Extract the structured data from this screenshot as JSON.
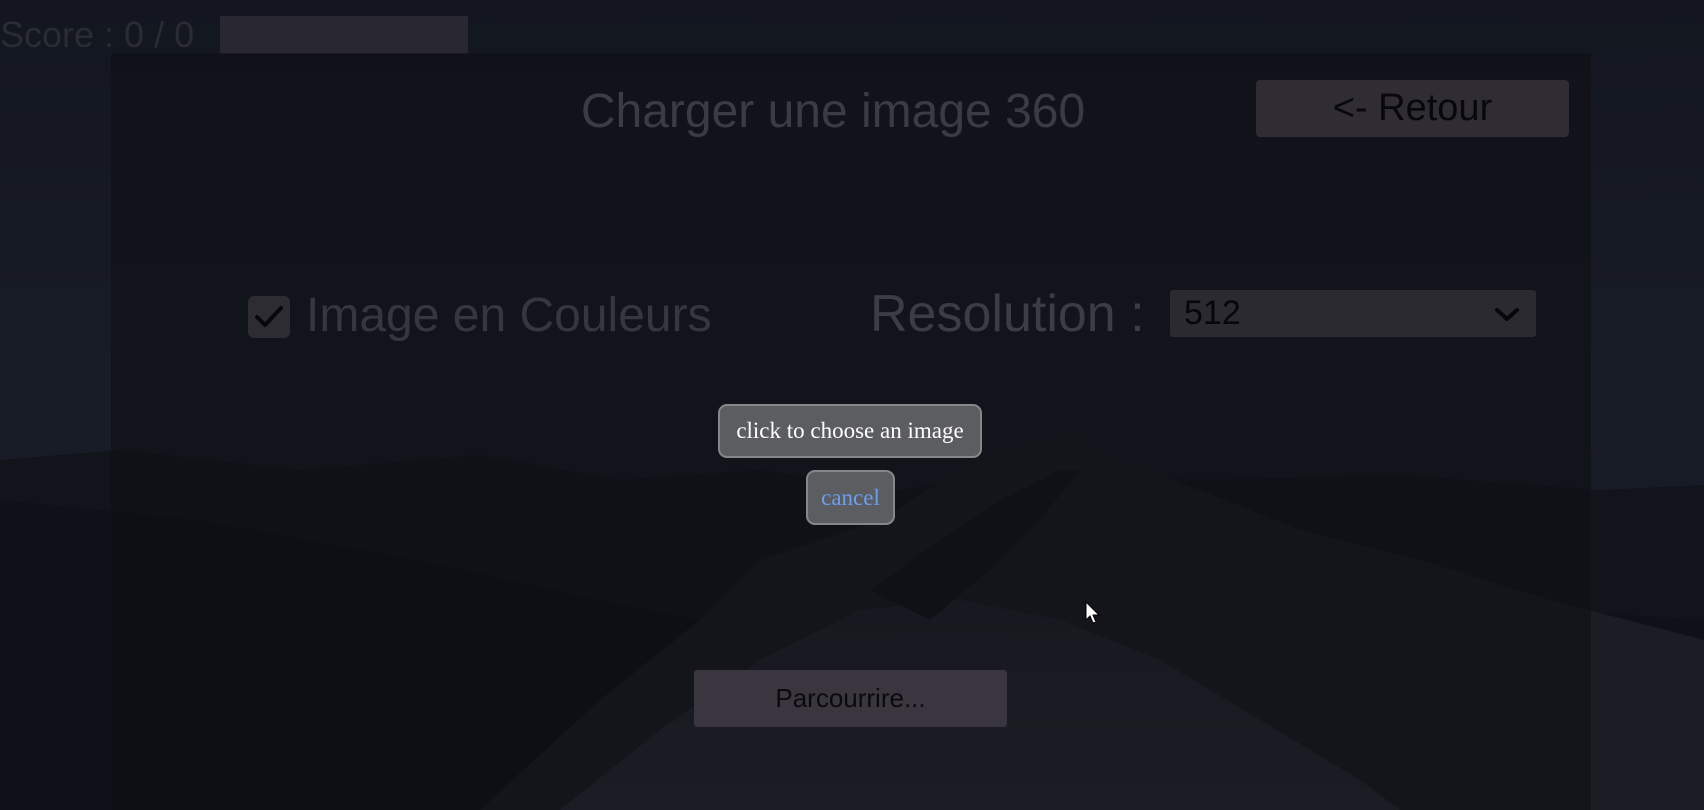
{
  "hud": {
    "score_text": "Score : 0 / 0"
  },
  "dialog": {
    "title": "Charger une image 360",
    "back_label": "<- Retour",
    "color_checkbox": {
      "label": "Image en Couleurs",
      "checked": true,
      "icon": "checkmark-icon"
    },
    "resolution": {
      "label": "Resolution :",
      "selected": "512",
      "icon": "chevron-down-icon"
    },
    "browse_label": "Parcourrire..."
  },
  "file_picker": {
    "choose_label": "click to choose an image",
    "cancel_label": "cancel"
  },
  "colors": {
    "overlay": "#0e0f14",
    "cancel_link": "#6c9ef0",
    "picker_button": "#5c5d61"
  }
}
